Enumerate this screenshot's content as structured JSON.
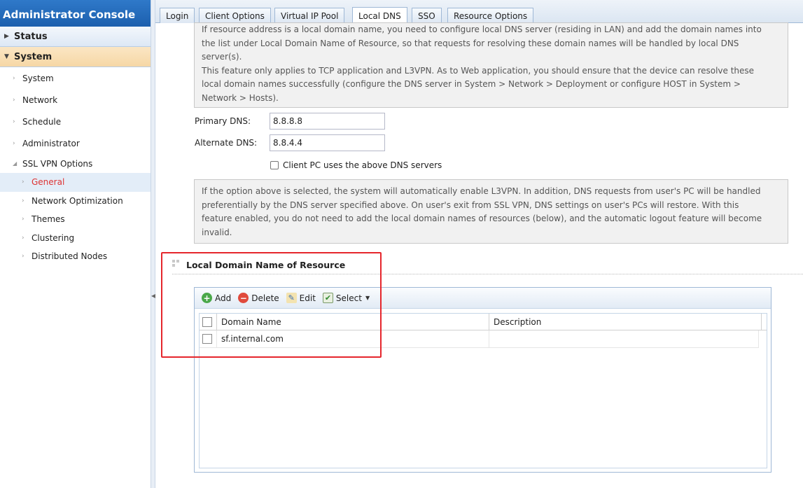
{
  "app": {
    "title": "Administrator Console"
  },
  "sidebar": {
    "status_label": "Status",
    "system_label": "System",
    "items": [
      {
        "label": "System"
      },
      {
        "label": "Network"
      },
      {
        "label": "Schedule"
      },
      {
        "label": "Administrator"
      },
      {
        "label": "SSL VPN Options"
      }
    ],
    "sub_items": [
      {
        "label": "General",
        "active": true
      },
      {
        "label": "Network Optimization"
      },
      {
        "label": "Themes"
      },
      {
        "label": "Clustering"
      },
      {
        "label": "Distributed Nodes"
      }
    ]
  },
  "tabs": [
    {
      "label": "Login"
    },
    {
      "label": "Client Options"
    },
    {
      "label": "Virtual IP Pool"
    },
    {
      "label": "Local DNS",
      "active": true
    },
    {
      "label": "SSO"
    },
    {
      "label": "Resource Options"
    }
  ],
  "info_top": {
    "line1": "If resource address is a local domain name, you need to configure local DNS server (residing in LAN) and add the domain names into",
    "line2": "the list under Local Domain Name of Resource, so that requests for resolving these domain names will be handled by local DNS",
    "line3": "server(s).",
    "line4": "This feature only applies to TCP application and L3VPN. As to Web application, you should ensure that the device can resolve these",
    "line5": "local domain names successfully (configure the DNS server in System > Network > Deployment or configure HOST in System >",
    "line6": "Network > Hosts)."
  },
  "form": {
    "primary_dns_label": "Primary DNS:",
    "primary_dns_value": "8.8.8.8",
    "alternate_dns_label": "Alternate DNS:",
    "alternate_dns_value": "8.8.4.4",
    "client_pc_label": "Client PC uses the above DNS servers",
    "client_pc_checked": false
  },
  "info_bottom": {
    "line1": "If the option above is selected, the system will automatically enable L3VPN. In addition, DNS requests from user's PC will be handled",
    "line2": "preferentially by the DNS server specified above. On user's exit from SSL VPN, DNS settings on user's PCs will restore. With this",
    "line3": "feature enabled, you do not need to add the local domain names of resources (below), and the automatic logout feature will become",
    "line4": "invalid."
  },
  "resource_section": {
    "title": "Local Domain Name of Resource",
    "toolbar": {
      "add_label": "Add",
      "delete_label": "Delete",
      "edit_label": "Edit",
      "select_label": "Select"
    },
    "columns": [
      "Domain Name",
      "Description"
    ],
    "rows": [
      {
        "domain": "sf.internal.com",
        "description": ""
      }
    ]
  },
  "colors": {
    "header_blue": "#1c5fae",
    "active_orange": "#f6d7a5",
    "highlight_red": "#e5262c",
    "active_link_red": "#dd3333"
  }
}
